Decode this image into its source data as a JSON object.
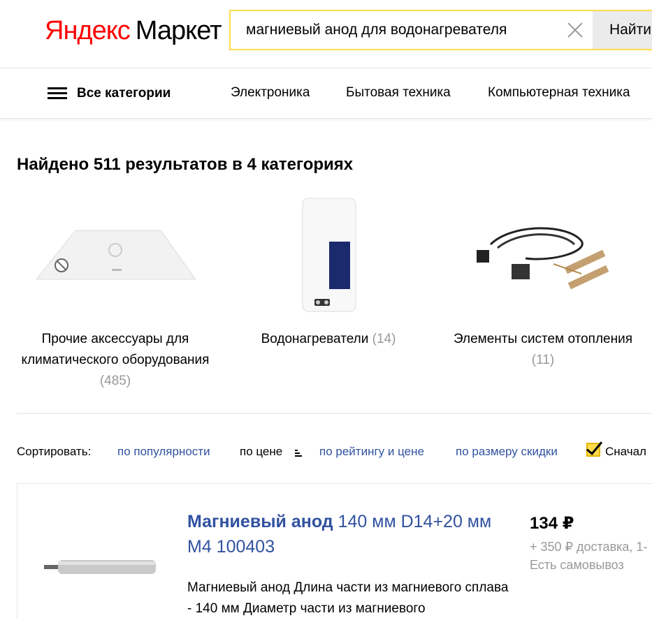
{
  "header": {
    "logo_ya": "Яндекс",
    "logo_market": "Маркет",
    "search_value": "магниевый анод для водонагревателя",
    "search_button": "Найти"
  },
  "nav": {
    "all_categories": "Все категории",
    "items": [
      "Электроника",
      "Бытовая техника",
      "Компьютерная техника"
    ]
  },
  "results": {
    "heading": "Найдено 511 результатов в 4 категориях",
    "categories": [
      {
        "name": "Прочие аксессуары для климатического оборудования",
        "count": "(485)"
      },
      {
        "name": "Водонагреватели",
        "count": "(14)"
      },
      {
        "name": "Элементы систем отопления",
        "count": "(11)"
      }
    ]
  },
  "sort": {
    "label": "Сортировать:",
    "options": [
      "по популярности",
      "по цене",
      "по рейтингу и цене",
      "по размеру скидки"
    ],
    "checkbox_label": "Сначал"
  },
  "product": {
    "title_bold": "Магниевый анод",
    "title_rest": " 140 мм D14+20 мм М4 100403",
    "description": "Магниевый анод Длина части из магниевого сплава - 140 мм Диаметр части из магниевого",
    "price": "134 ₽",
    "delivery": "+ 350 ₽ доставка, 1-",
    "pickup": "Есть самовывоз"
  },
  "colors": {
    "brand_red": "#ff0000",
    "search_border": "#ffdb4d",
    "link_blue": "#3152a0",
    "muted_gray": "#999999"
  },
  "icons": [
    "close-icon",
    "menu-icon",
    "sort-icon",
    "checkbox-icon"
  ]
}
